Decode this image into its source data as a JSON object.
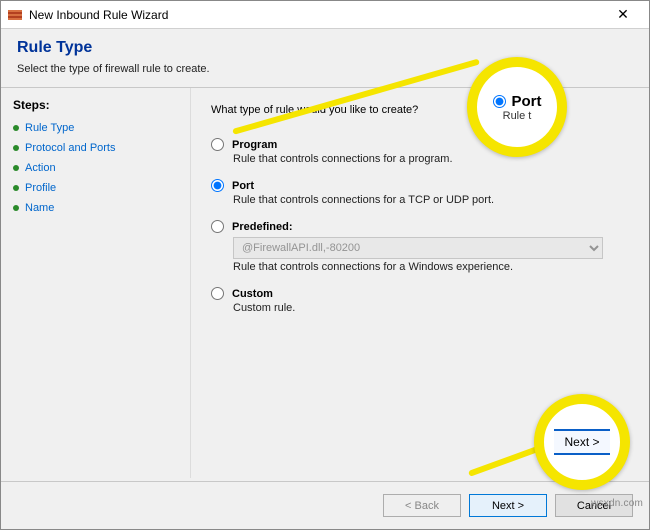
{
  "window": {
    "title": "New Inbound Rule Wizard",
    "close_glyph": "✕"
  },
  "header": {
    "title": "Rule Type",
    "subtitle": "Select the type of firewall rule to create."
  },
  "sidebar": {
    "label": "Steps:",
    "items": [
      {
        "label": "Rule Type",
        "active": true
      },
      {
        "label": "Protocol and Ports",
        "active": true
      },
      {
        "label": "Action",
        "active": false
      },
      {
        "label": "Profile",
        "active": false
      },
      {
        "label": "Name",
        "active": false
      }
    ]
  },
  "content": {
    "question": "What type of rule would you like to create?",
    "options": [
      {
        "key": "program",
        "label": "Program",
        "desc": "Rule that controls connections for a program.",
        "checked": false
      },
      {
        "key": "port",
        "label": "Port",
        "desc": "Rule that controls connections for a TCP or UDP port.",
        "checked": true
      },
      {
        "key": "predefined",
        "label": "Predefined:",
        "desc": "Rule that controls connections for a Windows experience.",
        "checked": false,
        "select_value": "@FirewallAPI.dll,-80200"
      },
      {
        "key": "custom",
        "label": "Custom",
        "desc": "Custom rule.",
        "checked": false
      }
    ]
  },
  "footer": {
    "back": "< Back",
    "next": "Next >",
    "cancel": "Cancel"
  },
  "highlight": {
    "port_label": "Port",
    "port_sub": "Rule t",
    "next_label": "Next >"
  },
  "watermark": "wsxdn.com"
}
